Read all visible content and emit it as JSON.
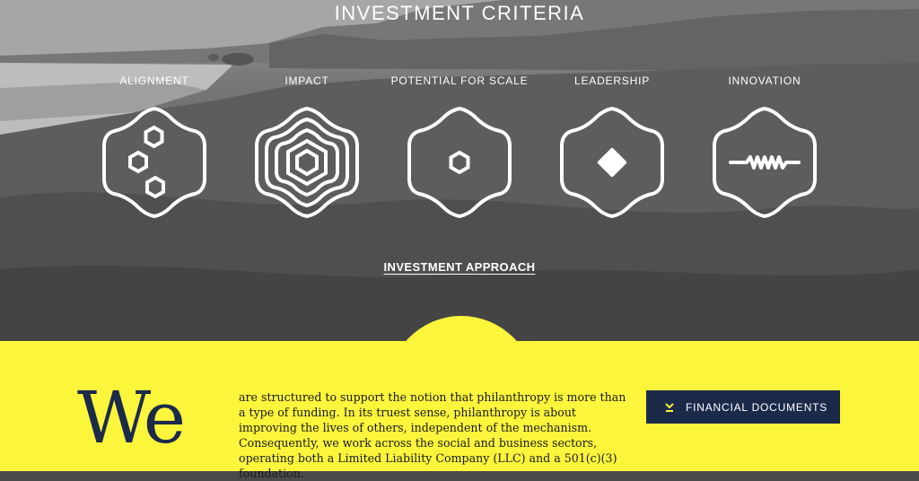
{
  "hero": {
    "title": "INVESTMENT CRITERIA",
    "criteria": [
      {
        "label": "ALIGNMENT",
        "icon": "stacked-hexagons-icon"
      },
      {
        "label": "IMPACT",
        "icon": "concentric-hexagons-icon"
      },
      {
        "label": "POTENTIAL FOR SCALE",
        "icon": "small-hexagon-icon"
      },
      {
        "label": "LEADERSHIP",
        "icon": "diamond-icon"
      },
      {
        "label": "INNOVATION",
        "icon": "zigzag-wave-icon"
      }
    ],
    "approach_link": "INVESTMENT APPROACH"
  },
  "about": {
    "lead_word": "We",
    "text": "are structured to support the notion that philanthropy is more than a type of funding. In its truest sense, philanthropy is about improving the lives of others, independent of the mechanism. Consequently, we work across the social and business sectors, operating both a Limited Liability Company (LLC) and a 501(c)(3) foundation.",
    "button_label": "FINANCIAL DOCUMENTS",
    "button_icon": "chevron-down-icon"
  },
  "colors": {
    "accent_yellow": "#fbf53c",
    "navy": "#1c2a4a",
    "white": "#ffffff"
  }
}
